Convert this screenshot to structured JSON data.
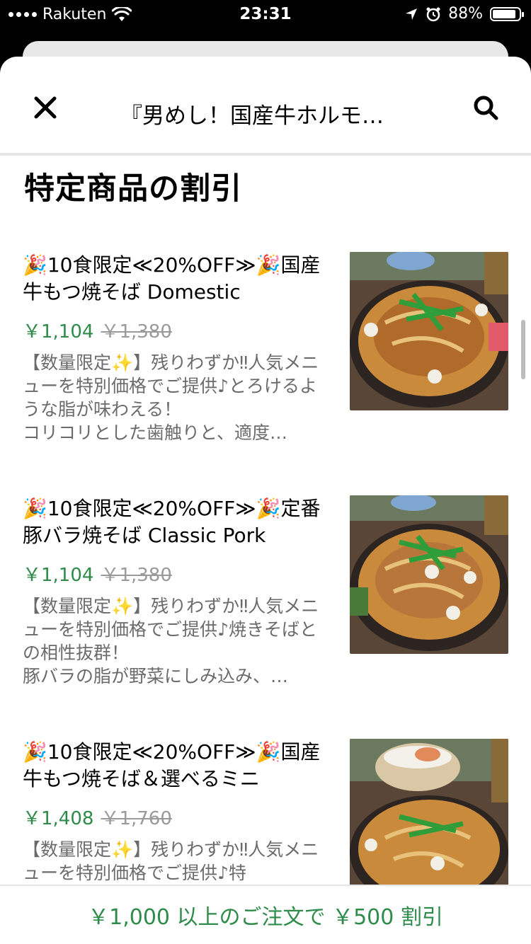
{
  "status_bar": {
    "carrier": "Rakuten",
    "time": "23:31",
    "battery": "88%",
    "battery_level": 0.88
  },
  "header": {
    "title": "『男めし！国産牛ホルモ…",
    "close_icon": "close-icon",
    "search_icon": "search-icon"
  },
  "section": {
    "title": "特定商品の割引"
  },
  "items": [
    {
      "name": "🎉10食限定≪20%OFF≫🎉国産牛もつ焼そば Domestic",
      "price": "￥1,104",
      "original_price": "￥1,380",
      "description": "【数量限定✨】残りわずか‼人気メニューを特別価格でご提供♪とろけるような脂が味わえる！\nコリコリとした歯触りと、適度…"
    },
    {
      "name": "🎉10食限定≪20%OFF≫🎉定番豚バラ焼そば Classic Pork",
      "price": "￥1,104",
      "original_price": "￥1,380",
      "description": "【数量限定✨】残りわずか‼人気メニューを特別価格でご提供♪焼きそばとの相性抜群！\n豚バラの脂が野菜にしみ込み、…"
    },
    {
      "name": "🎉10食限定≪20%OFF≫🎉国産牛もつ焼そば＆選べるミニ",
      "price": "￥1,408",
      "original_price": "￥1,760",
      "description": "【数量限定✨】残りわずか‼人気メニューを特別価格でご提供♪特"
    }
  ],
  "promo": {
    "text": "￥1,000 以上のご注文で ￥500 割引"
  },
  "colors": {
    "accent_green": "#2e8b4a",
    "strike_gray": "#9a9a9a"
  }
}
